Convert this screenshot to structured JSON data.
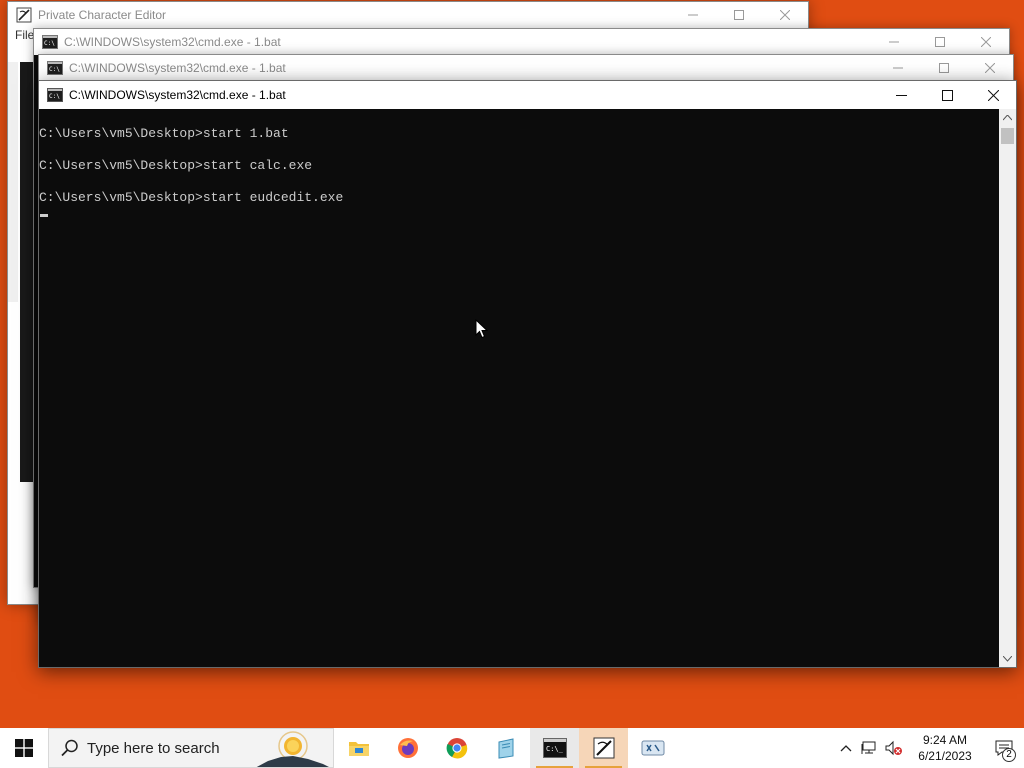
{
  "windows": {
    "private_char_editor": {
      "title": "Private Character Editor",
      "menu_first": "File"
    },
    "cmd_back2": {
      "title": "C:\\WINDOWS\\system32\\cmd.exe - 1.bat"
    },
    "cmd_back1": {
      "title": "C:\\WINDOWS\\system32\\cmd.exe - 1.bat"
    },
    "cmd_active": {
      "title": "C:\\WINDOWS\\system32\\cmd.exe - 1.bat",
      "lines": [
        "C:\\Users\\vm5\\Desktop>start 1.bat",
        "C:\\Users\\vm5\\Desktop>start calc.exe",
        "C:\\Users\\vm5\\Desktop>start eudcedit.exe"
      ]
    }
  },
  "taskbar": {
    "search_placeholder": "Type here to search",
    "apps": [
      "file-explorer",
      "firefox",
      "chrome",
      "notepad",
      "cmd",
      "private-character-editor",
      "app-7"
    ],
    "clock_time": "9:24 AM",
    "clock_date": "6/21/2023",
    "notification_count": "2"
  },
  "colors": {
    "desktop": "#e04d12",
    "console_bg": "#0c0c0c",
    "console_text": "#cccccc"
  }
}
